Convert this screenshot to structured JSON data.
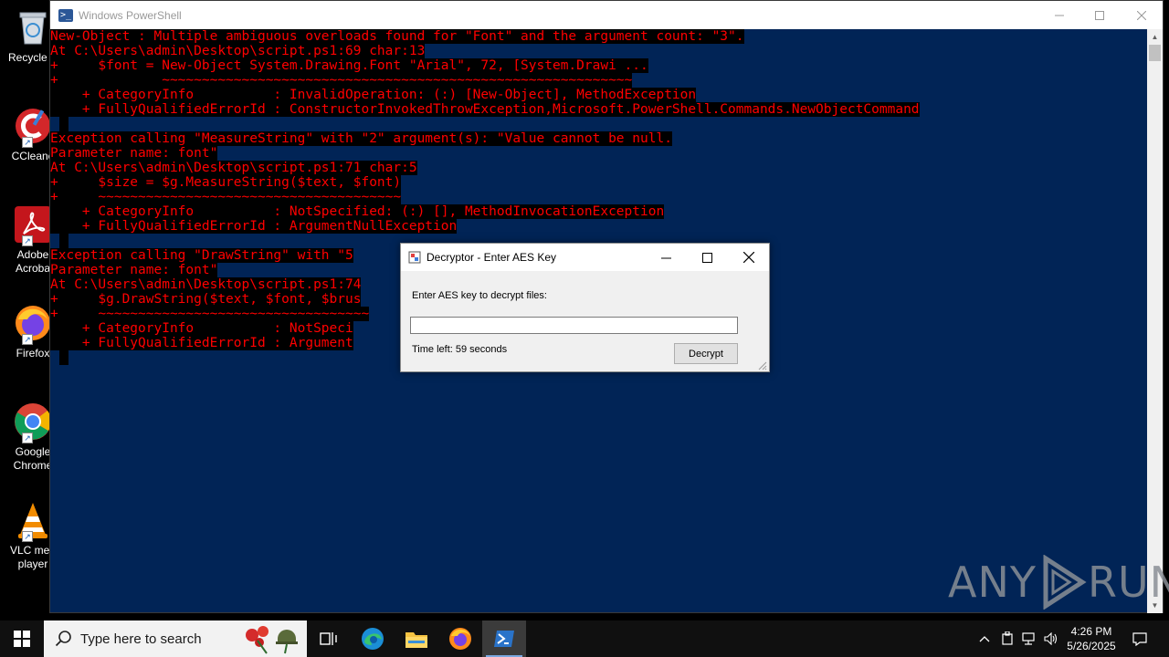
{
  "desktop": {
    "icons": [
      {
        "label": "Recycle Bin",
        "display": "Recycle B"
      },
      {
        "label": "CCleaner",
        "display": "CCleane"
      },
      {
        "label": "Adobe Acrobat",
        "display": "Adobe\nAcroba"
      },
      {
        "label": "Firefox",
        "display": "Firefox"
      },
      {
        "label": "Google Chrome",
        "display": "Google\nChrome"
      },
      {
        "label": "VLC media player",
        "display": "VLC med\nplayer"
      }
    ]
  },
  "powershell": {
    "title": "Windows PowerShell",
    "lines": [
      "New-Object : Multiple ambiguous overloads found for \"Font\" and the argument count: \"3\".",
      "At C:\\Users\\admin\\Desktop\\script.ps1:69 char:13",
      "+     $font = New-Object System.Drawing.Font \"Arial\", 72, [System.Drawi ...",
      "+             ~~~~~~~~~~~~~~~~~~~~~~~~~~~~~~~~~~~~~~~~~~~~~~~~~~~~~~~~~~~",
      "    + CategoryInfo          : InvalidOperation: (:) [New-Object], MethodException",
      "    + FullyQualifiedErrorId : ConstructorInvokedThrowException,Microsoft.PowerShell.Commands.NewObjectCommand",
      "",
      "Exception calling \"MeasureString\" with \"2\" argument(s): \"Value cannot be null.",
      "Parameter name: font\"",
      "At C:\\Users\\admin\\Desktop\\script.ps1:71 char:5",
      "+     $size = $g.MeasureString($text, $font)",
      "+     ~~~~~~~~~~~~~~~~~~~~~~~~~~~~~~~~~~~~~~",
      "    + CategoryInfo          : NotSpecified: (:) [], MethodInvocationException",
      "    + FullyQualifiedErrorId : ArgumentNullException",
      "",
      "Exception calling \"DrawString\" with \"5",
      "Parameter name: font\"",
      "At C:\\Users\\admin\\Desktop\\script.ps1:74",
      "+     $g.DrawString($text, $font, $brus",
      "+     ~~~~~~~~~~~~~~~~~~~~~~~~~~~~~~~~~~",
      "    + CategoryInfo          : NotSpeci",
      "    + FullyQualifiedErrorId : Argument",
      ""
    ]
  },
  "dialog": {
    "title": "Decryptor - Enter AES Key",
    "prompt": "Enter AES key to decrypt files:",
    "key_value": "",
    "time_left": "Time left: 59 seconds",
    "decrypt_label": "Decrypt"
  },
  "watermark": {
    "text_left": "ANY",
    "text_right": "RUN"
  },
  "taskbar": {
    "search_placeholder": "Type here to search",
    "apps": [
      "task-view",
      "edge",
      "file-explorer",
      "firefox",
      "powershell"
    ],
    "active_app": "powershell",
    "clock_time": "4:26 PM",
    "clock_date": "5/26/2025"
  },
  "colors": {
    "console_bg": "#012456",
    "error_fg": "#ff0000",
    "error_bg": "#000000"
  }
}
